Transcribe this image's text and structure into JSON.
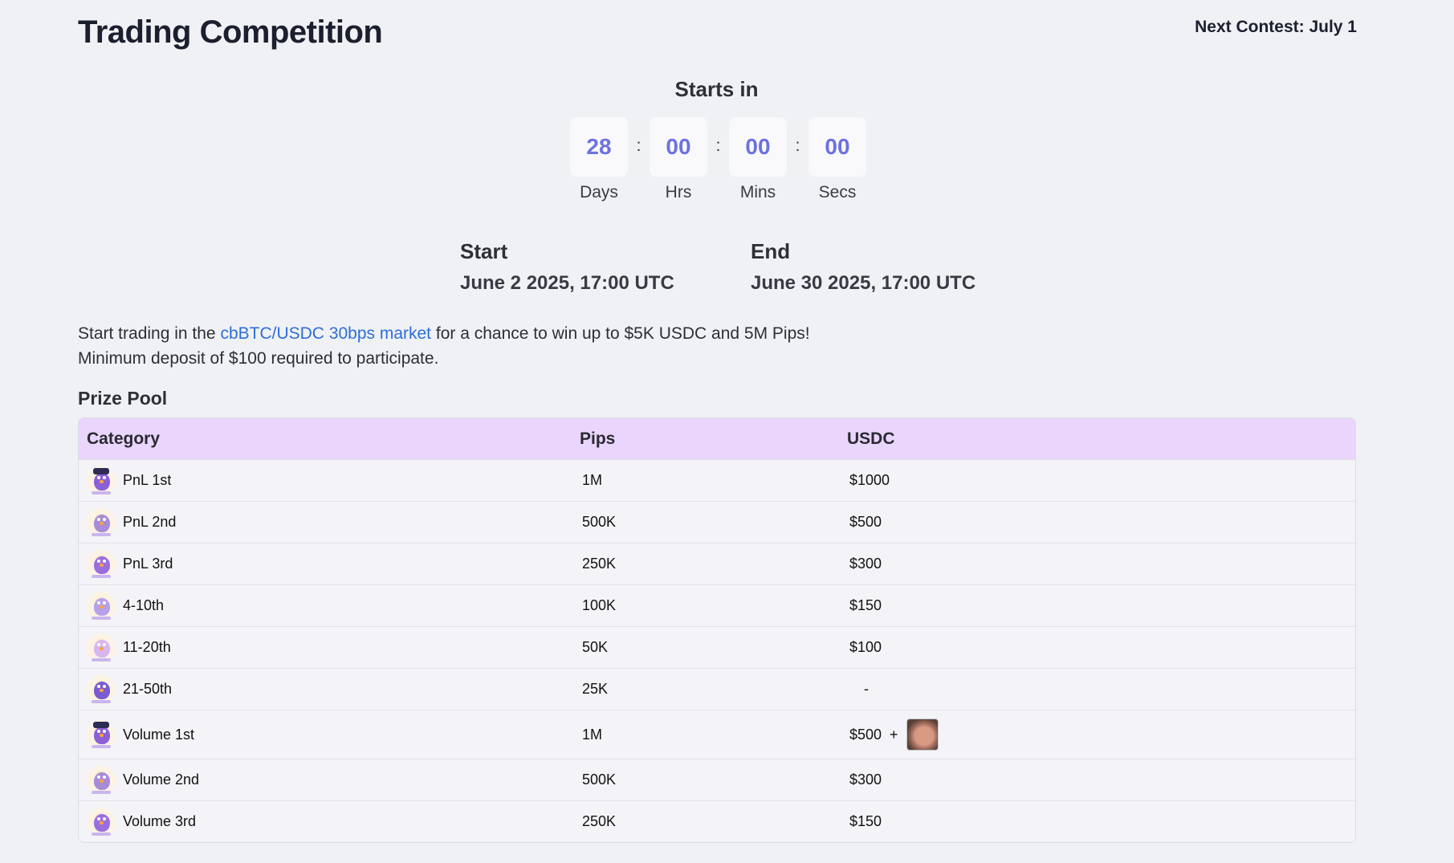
{
  "header": {
    "title": "Trading Competition",
    "next_contest": "Next Contest: July 1"
  },
  "countdown": {
    "heading": "Starts in",
    "separator": ":",
    "units": [
      {
        "value": "28",
        "label": "Days"
      },
      {
        "value": "00",
        "label": "Hrs"
      },
      {
        "value": "00",
        "label": "Mins"
      },
      {
        "value": "00",
        "label": "Secs"
      }
    ]
  },
  "schedule": {
    "start_label": "Start",
    "start_value": "June 2 2025, 17:00 UTC",
    "end_label": "End",
    "end_value": "June 30 2025, 17:00 UTC"
  },
  "intro": {
    "line1_before": "Start trading in the ",
    "market_link": "cbBTC/USDC 30bps market",
    "line1_after": " for a chance to win up to $5K USDC and 5M Pips!",
    "line2": "Minimum deposit of $100 required to participate."
  },
  "prize_pool": {
    "title": "Prize Pool",
    "columns": [
      "Category",
      "Pips",
      "USDC"
    ],
    "rows": [
      {
        "category": "PnL 1st",
        "pips": "1M",
        "usdc": "$1000",
        "avatar_color": "#8c5fd6",
        "hat": true
      },
      {
        "category": "PnL 2nd",
        "pips": "500K",
        "usdc": "$500",
        "avatar_color": "#a98bd8",
        "hat": false
      },
      {
        "category": "PnL 3rd",
        "pips": "250K",
        "usdc": "$300",
        "avatar_color": "#9a6ee0",
        "hat": false
      },
      {
        "category": "4-10th",
        "pips": "100K",
        "usdc": "$150",
        "avatar_color": "#b6a0ea",
        "hat": false
      },
      {
        "category": "11-20th",
        "pips": "50K",
        "usdc": "$100",
        "avatar_color": "#d8b6f0",
        "hat": false
      },
      {
        "category": "21-50th",
        "pips": "25K",
        "usdc": "-",
        "avatar_color": "#7a5cd0",
        "hat": false
      },
      {
        "category": "Volume 1st",
        "pips": "1M",
        "usdc": "$500",
        "usdc_extra": "+",
        "avatar_color": "#8c5fd6",
        "hat": true
      },
      {
        "category": "Volume 2nd",
        "pips": "500K",
        "usdc": "$300",
        "avatar_color": "#a98bd8",
        "hat": false
      },
      {
        "category": "Volume 3rd",
        "pips": "250K",
        "usdc": "$150",
        "avatar_color": "#9a6ee0",
        "hat": false
      }
    ]
  }
}
